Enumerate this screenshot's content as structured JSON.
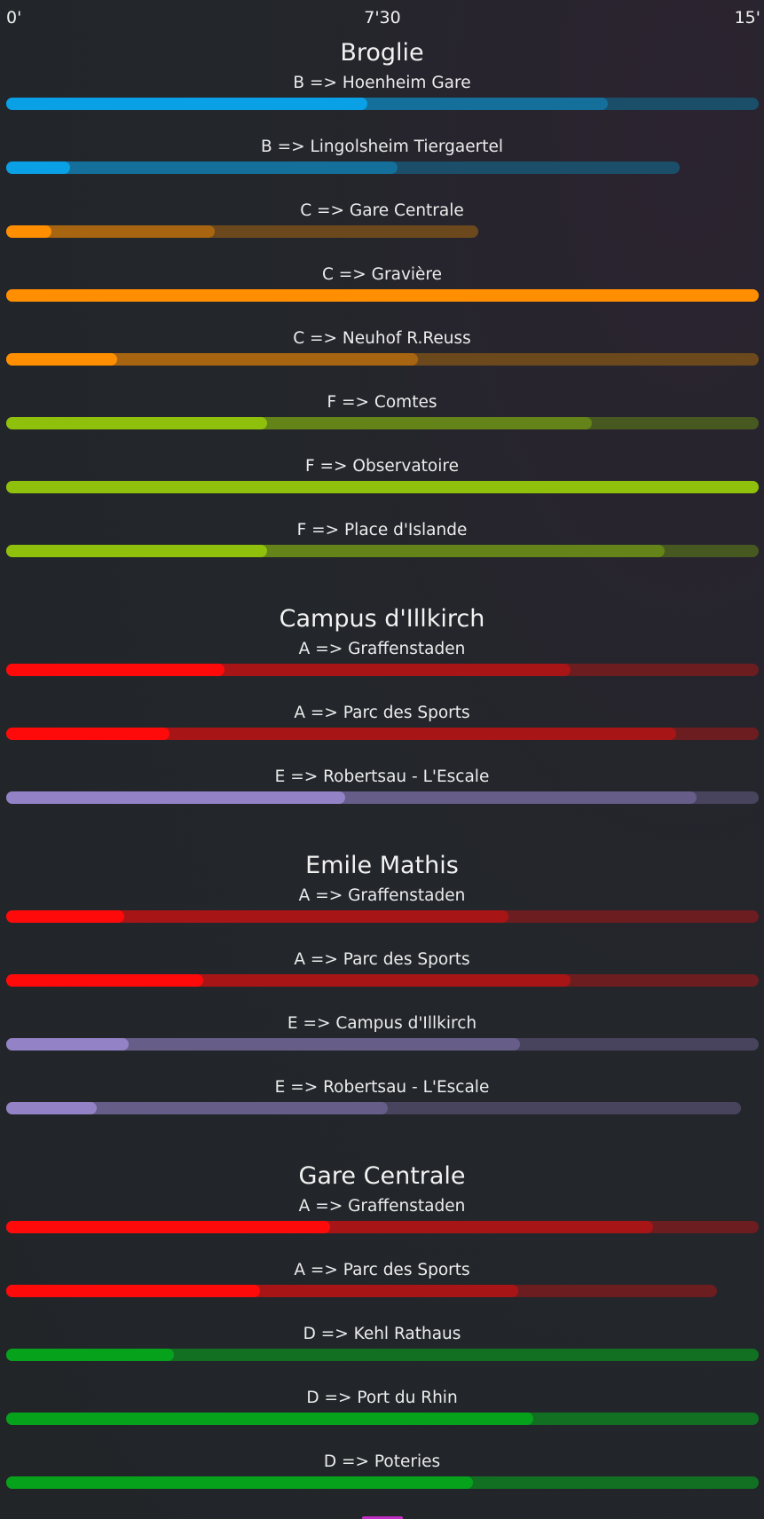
{
  "scale": {
    "start": "0'",
    "middle": "7'30",
    "end": "15'"
  },
  "line_colors": {
    "A": "#ff0a0a",
    "B": "#0aa0e6",
    "C": "#ff8f00",
    "D": "#07a21c",
    "E": "#9382c6",
    "F": "#8fc10c"
  },
  "stations": [
    {
      "name": "Broglie",
      "lines": [
        {
          "label": "B => Hoenheim Gare",
          "line": "B",
          "progress": [
            0.48,
            0.8,
            1.0
          ]
        },
        {
          "label": "B => Lingolsheim Tiergaertel",
          "line": "B",
          "progress": [
            0.085,
            0.52,
            0.895
          ]
        },
        {
          "label": "C => Gare Centrale",
          "line": "C",
          "progress": [
            0.06,
            0.277,
            0.627
          ]
        },
        {
          "label": "C => Gravière",
          "line": "C",
          "progress": [
            1.0,
            1.0,
            1.0
          ]
        },
        {
          "label": "C => Neuhof R.Reuss",
          "line": "C",
          "progress": [
            0.147,
            0.547,
            1.0
          ]
        },
        {
          "label": "F => Comtes",
          "line": "F",
          "progress": [
            0.347,
            0.778,
            1.0
          ]
        },
        {
          "label": "F => Observatoire",
          "line": "F",
          "progress": [
            1.0,
            1.0,
            1.0
          ]
        },
        {
          "label": "F => Place d'Islande",
          "line": "F",
          "progress": [
            0.347,
            0.875,
            1.0
          ]
        }
      ]
    },
    {
      "name": "Campus d'Illkirch",
      "lines": [
        {
          "label": "A => Graffenstaden",
          "line": "A",
          "progress": [
            0.29,
            0.75,
            1.0
          ]
        },
        {
          "label": "A => Parc des Sports",
          "line": "A",
          "progress": [
            0.217,
            0.89,
            1.0
          ]
        },
        {
          "label": "E => Robertsau - L'Escale",
          "line": "E",
          "progress": [
            0.45,
            0.917,
            1.0
          ]
        }
      ]
    },
    {
      "name": "Emile Mathis",
      "lines": [
        {
          "label": "A => Graffenstaden",
          "line": "A",
          "progress": [
            0.157,
            0.667,
            1.0
          ]
        },
        {
          "label": "A => Parc des Sports",
          "line": "A",
          "progress": [
            0.262,
            0.75,
            1.0
          ]
        },
        {
          "label": "E => Campus d'Illkirch",
          "line": "E",
          "progress": [
            0.163,
            0.683,
            1.0
          ]
        },
        {
          "label": "E => Robertsau - L'Escale",
          "line": "E",
          "progress": [
            0.12,
            0.507,
            0.977
          ]
        }
      ]
    },
    {
      "name": "Gare Centrale",
      "lines": [
        {
          "label": "A => Graffenstaden",
          "line": "A",
          "progress": [
            0.43,
            0.86,
            1.0
          ]
        },
        {
          "label": "A => Parc des Sports",
          "line": "A",
          "progress": [
            0.337,
            0.68,
            0.945
          ]
        },
        {
          "label": "D => Kehl Rathaus",
          "line": "D",
          "progress": [
            0.223,
            1.0,
            1.0
          ]
        },
        {
          "label": "D => Port du Rhin",
          "line": "D",
          "progress": [
            0.7,
            1.0,
            1.0
          ]
        },
        {
          "label": "D => Poteries",
          "line": "D",
          "progress": [
            0.62,
            1.0,
            1.0
          ]
        }
      ]
    }
  ]
}
